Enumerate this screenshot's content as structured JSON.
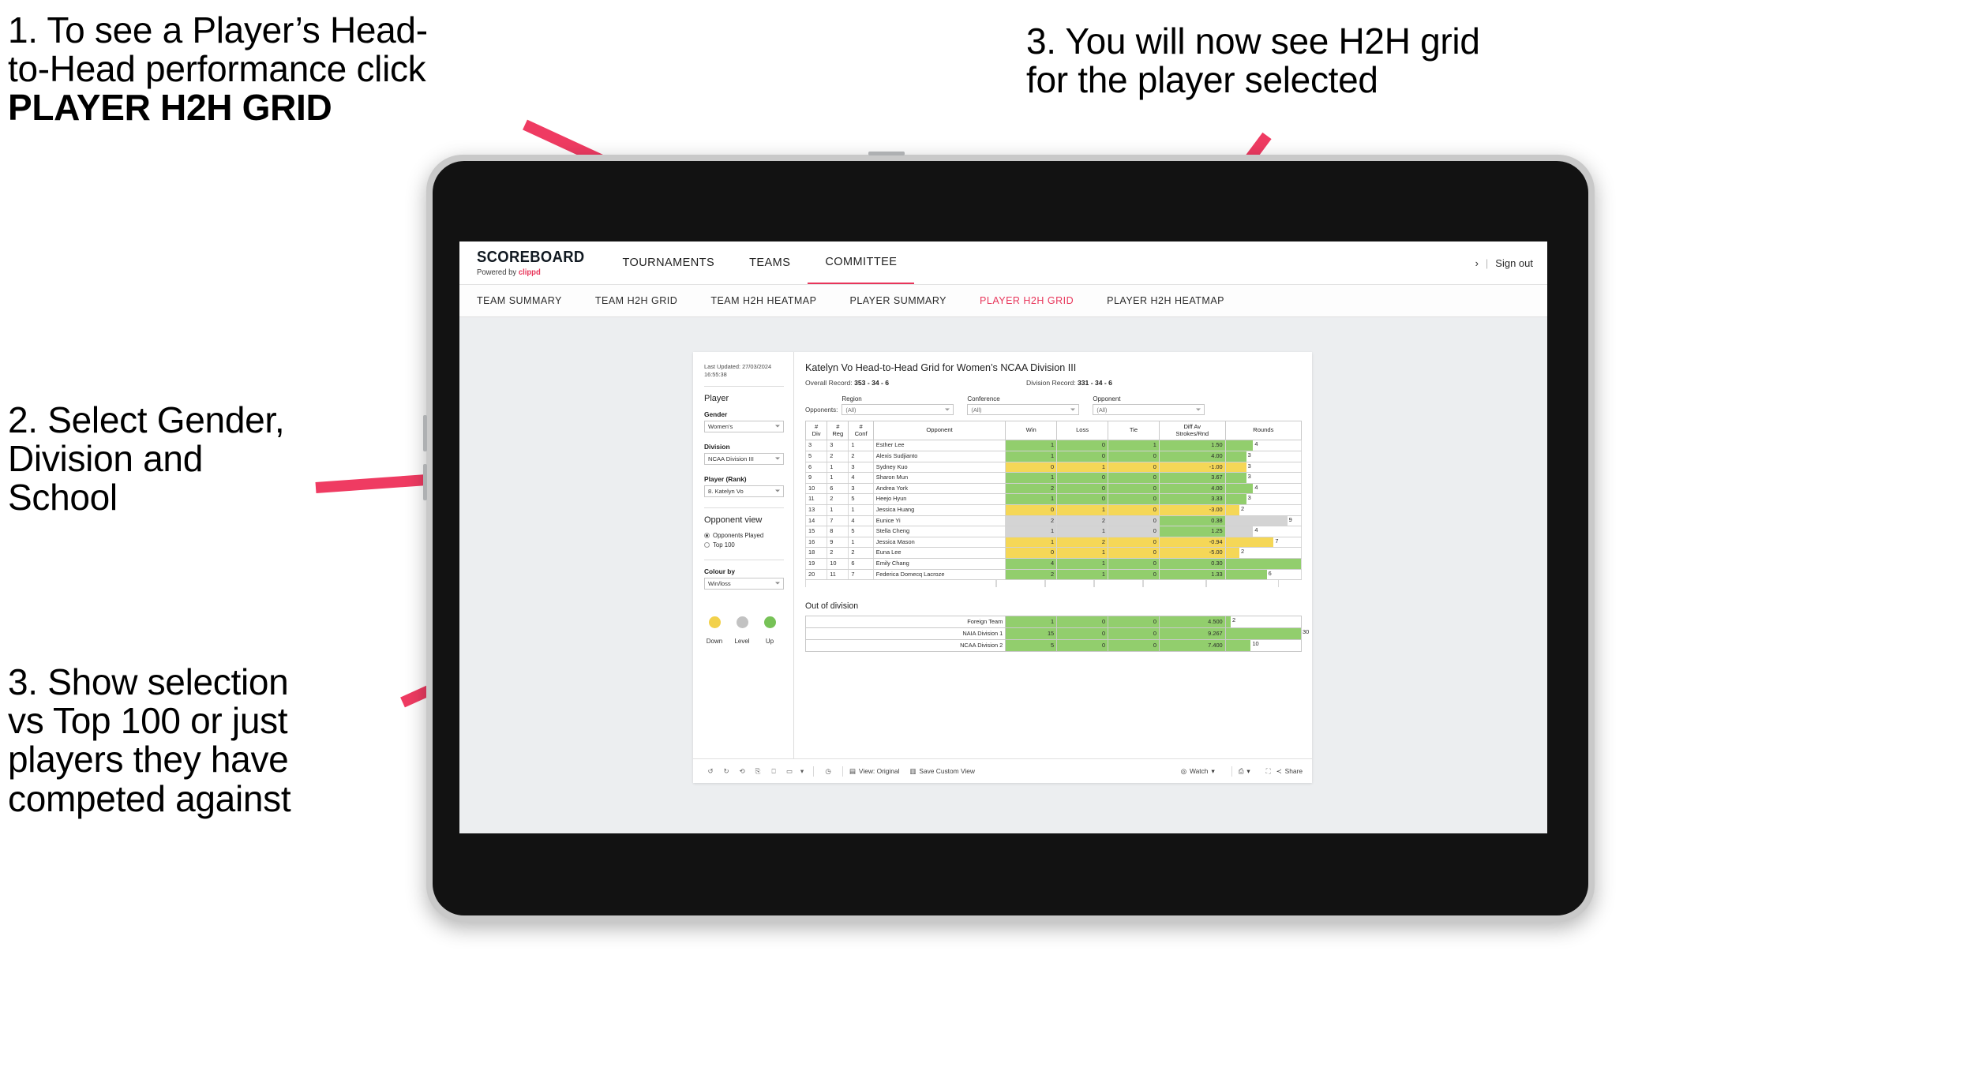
{
  "annotations": {
    "a1_line1": "1. To see a Player’s Head-",
    "a1_line2": "to-Head performance click",
    "a1_bold": "PLAYER H2H GRID",
    "a2_line1": "2. Select Gender,",
    "a2_line2": "Division and",
    "a2_line3": "School",
    "a3_top_line1": "3. You will now see H2H grid",
    "a3_top_line2": "for the player selected",
    "a3_left_line1": "3. Show selection",
    "a3_left_line2": "vs Top 100 or just",
    "a3_left_line3": "players they have",
    "a3_left_line4": "competed against",
    "arrow_color": "#ef3b62"
  },
  "app": {
    "brand_name": "SCOREBOARD",
    "brand_sub_prefix": "Powered by ",
    "brand_sub_accent": "clippd",
    "accent_color": "#e8355a",
    "top_nav": [
      {
        "label": "TOURNAMENTS",
        "active": false
      },
      {
        "label": "TEAMS",
        "active": false
      },
      {
        "label": "COMMITTEE",
        "active": true
      }
    ],
    "header_right": {
      "chevron": "›",
      "separator": "|",
      "sign_out": "Sign out"
    },
    "sub_nav": [
      {
        "label": "TEAM SUMMARY",
        "active": false
      },
      {
        "label": "TEAM H2H GRID",
        "active": false
      },
      {
        "label": "TEAM H2H HEATMAP",
        "active": false
      },
      {
        "label": "PLAYER SUMMARY",
        "active": false
      },
      {
        "label": "PLAYER H2H GRID",
        "active": true
      },
      {
        "label": "PLAYER H2H HEATMAP",
        "active": false
      }
    ]
  },
  "panel": {
    "last_updated_line1": "Last Updated: 27/03/2024",
    "last_updated_line2": "16:55:38",
    "player_heading": "Player",
    "gender_label": "Gender",
    "gender_value": "Women's",
    "division_label": "Division",
    "division_value": "NCAA Division III",
    "player_rank_label": "Player (Rank)",
    "player_rank_value": "8. Katelyn Vo",
    "opponent_view_heading": "Opponent view",
    "opponent_view_options": [
      {
        "label": "Opponents Played",
        "selected": true
      },
      {
        "label": "Top 100",
        "selected": false
      }
    ],
    "colour_by_label": "Colour by",
    "colour_by_value": "Win/loss",
    "legend": [
      {
        "label": "Down",
        "color": "#f2d14b"
      },
      {
        "label": "Level",
        "color": "#c2c2c2"
      },
      {
        "label": "Up",
        "color": "#77c257"
      }
    ]
  },
  "viz": {
    "title": "Katelyn Vo Head-to-Head Grid for Women’s NCAA Division III",
    "overall_record_label": "Overall Record: ",
    "overall_record_value": "353 -  34 - 6",
    "division_record_label": "Division Record: ",
    "division_record_value": "331 -  34 - 6",
    "opponents_label": "Opponents:",
    "filters": [
      {
        "label": "Region",
        "value": "(All)"
      },
      {
        "label": "Conference",
        "value": "(All)"
      },
      {
        "label": "Opponent",
        "value": "(All)"
      }
    ],
    "out_of_division_title": "Out of division"
  },
  "chart_data": {
    "type": "table",
    "title": "Katelyn Vo Head-to-Head Grid for Women’s NCAA Division III",
    "columns": [
      "# Div",
      "# Reg",
      "# Conf",
      "Opponent",
      "Win",
      "Loss",
      "Tie",
      "Diff Av Strokes/Rnd",
      "Rounds"
    ],
    "column_header_lines": [
      [
        "#",
        "Div"
      ],
      [
        "#",
        "Reg"
      ],
      [
        "#",
        "Conf"
      ],
      [
        "Opponent"
      ],
      [
        "Win"
      ],
      [
        "Loss"
      ],
      [
        "Tie"
      ],
      [
        "Diff Av",
        "Strokes/Rnd"
      ],
      [
        "Rounds"
      ]
    ],
    "rows": [
      {
        "div": "3",
        "reg": "3",
        "conf": "1",
        "opponent": "Esther Lee",
        "win": "1",
        "loss": "0",
        "tie": "1",
        "diff": "1.50",
        "rounds": "4",
        "color": "up"
      },
      {
        "div": "5",
        "reg": "2",
        "conf": "2",
        "opponent": "Alexis Sudjianto",
        "win": "1",
        "loss": "0",
        "tie": "0",
        "diff": "4.00",
        "rounds": "3",
        "color": "up"
      },
      {
        "div": "6",
        "reg": "1",
        "conf": "3",
        "opponent": "Sydney Kuo",
        "win": "0",
        "loss": "1",
        "tie": "0",
        "diff": "-1.00",
        "rounds": "3",
        "color": "down"
      },
      {
        "div": "9",
        "reg": "1",
        "conf": "4",
        "opponent": "Sharon Mun",
        "win": "1",
        "loss": "0",
        "tie": "0",
        "diff": "3.67",
        "rounds": "3",
        "color": "up"
      },
      {
        "div": "10",
        "reg": "6",
        "conf": "3",
        "opponent": "Andrea York",
        "win": "2",
        "loss": "0",
        "tie": "0",
        "diff": "4.00",
        "rounds": "4",
        "color": "up"
      },
      {
        "div": "11",
        "reg": "2",
        "conf": "5",
        "opponent": "Heejo Hyun",
        "win": "1",
        "loss": "0",
        "tie": "0",
        "diff": "3.33",
        "rounds": "3",
        "color": "up"
      },
      {
        "div": "13",
        "reg": "1",
        "conf": "1",
        "opponent": "Jessica Huang",
        "win": "0",
        "loss": "1",
        "tie": "0",
        "diff": "-3.00",
        "rounds": "2",
        "color": "down"
      },
      {
        "div": "14",
        "reg": "7",
        "conf": "4",
        "opponent": "Eunice Yi",
        "win": "2",
        "loss": "2",
        "tie": "0",
        "diff": "0.38",
        "rounds": "9",
        "color": "level"
      },
      {
        "div": "15",
        "reg": "8",
        "conf": "5",
        "opponent": "Stella Cheng",
        "win": "1",
        "loss": "1",
        "tie": "0",
        "diff": "1.25",
        "rounds": "4",
        "color": "level"
      },
      {
        "div": "16",
        "reg": "9",
        "conf": "1",
        "opponent": "Jessica Mason",
        "win": "1",
        "loss": "2",
        "tie": "0",
        "diff": "-0.94",
        "rounds": "7",
        "color": "down"
      },
      {
        "div": "18",
        "reg": "2",
        "conf": "2",
        "opponent": "Euna Lee",
        "win": "0",
        "loss": "1",
        "tie": "0",
        "diff": "-5.00",
        "rounds": "2",
        "color": "down"
      },
      {
        "div": "19",
        "reg": "10",
        "conf": "6",
        "opponent": "Emily Chang",
        "win": "4",
        "loss": "1",
        "tie": "0",
        "diff": "0.30",
        "rounds": "11",
        "color": "up"
      },
      {
        "div": "20",
        "reg": "11",
        "conf": "7",
        "opponent": "Federica Domecq Lacroze",
        "win": "2",
        "loss": "1",
        "tie": "0",
        "diff": "1.33",
        "rounds": "6",
        "color": "up"
      }
    ],
    "out_of_division_rows": [
      {
        "opponent": "Foreign Team",
        "win": "1",
        "loss": "0",
        "tie": "0",
        "diff": "4.500",
        "rounds": "2",
        "color": "up"
      },
      {
        "opponent": "NAIA Division 1",
        "win": "15",
        "loss": "0",
        "tie": "0",
        "diff": "9.267",
        "rounds": "30",
        "color": "up"
      },
      {
        "opponent": "NCAA Division 2",
        "win": "5",
        "loss": "0",
        "tie": "0",
        "diff": "7.400",
        "rounds": "10",
        "color": "up"
      }
    ],
    "colors": {
      "up": "#92ce6d",
      "down": "#f5d757",
      "level": "#d4d4d4"
    },
    "diff_colors": {
      "up": "#92ce6d",
      "down": "#f5d757",
      "level": "#92ce6d"
    }
  },
  "toolbar": {
    "view_label": "View: Original",
    "save_label": "Save Custom View",
    "watch_label": "Watch",
    "share_label": "Share"
  }
}
